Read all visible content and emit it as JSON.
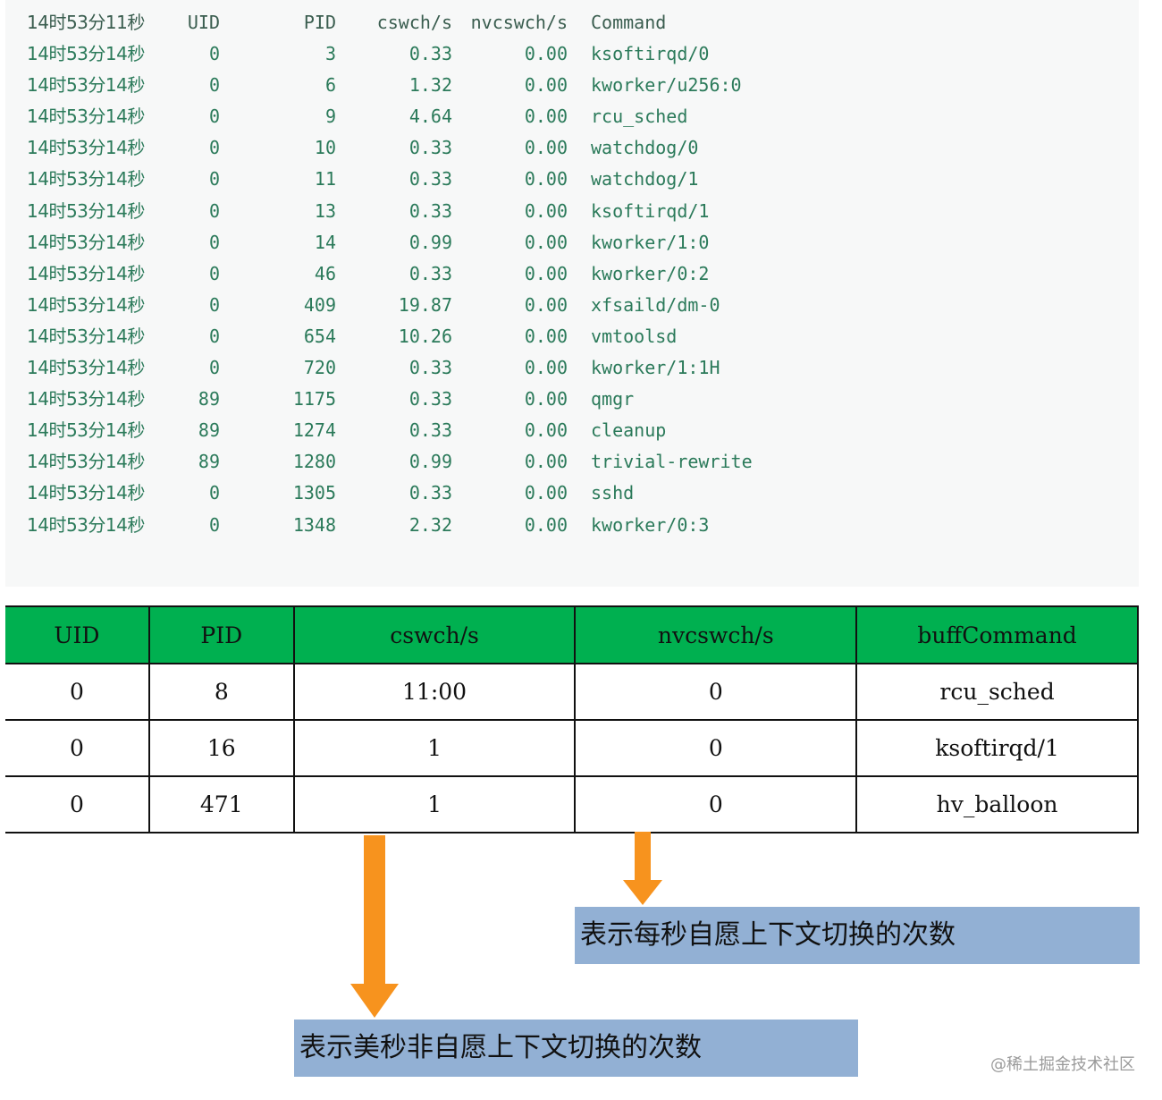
{
  "terminal": {
    "header": {
      "time": "14时53分11秒",
      "uid": "UID",
      "pid": "PID",
      "cswch": "cswch/s",
      "nvcswch": "nvcswch/s",
      "command": "Command"
    },
    "rows": [
      {
        "time": "14时53分14秒",
        "uid": "0",
        "pid": "3",
        "cswch": "0.33",
        "nvcswch": "0.00",
        "command": "ksoftirqd/0"
      },
      {
        "time": "14时53分14秒",
        "uid": "0",
        "pid": "6",
        "cswch": "1.32",
        "nvcswch": "0.00",
        "command": "kworker/u256:0"
      },
      {
        "time": "14时53分14秒",
        "uid": "0",
        "pid": "9",
        "cswch": "4.64",
        "nvcswch": "0.00",
        "command": "rcu_sched"
      },
      {
        "time": "14时53分14秒",
        "uid": "0",
        "pid": "10",
        "cswch": "0.33",
        "nvcswch": "0.00",
        "command": "watchdog/0"
      },
      {
        "time": "14时53分14秒",
        "uid": "0",
        "pid": "11",
        "cswch": "0.33",
        "nvcswch": "0.00",
        "command": "watchdog/1"
      },
      {
        "time": "14时53分14秒",
        "uid": "0",
        "pid": "13",
        "cswch": "0.33",
        "nvcswch": "0.00",
        "command": "ksoftirqd/1"
      },
      {
        "time": "14时53分14秒",
        "uid": "0",
        "pid": "14",
        "cswch": "0.99",
        "nvcswch": "0.00",
        "command": "kworker/1:0"
      },
      {
        "time": "14时53分14秒",
        "uid": "0",
        "pid": "46",
        "cswch": "0.33",
        "nvcswch": "0.00",
        "command": "kworker/0:2"
      },
      {
        "time": "14时53分14秒",
        "uid": "0",
        "pid": "409",
        "cswch": "19.87",
        "nvcswch": "0.00",
        "command": "xfsaild/dm-0"
      },
      {
        "time": "14时53分14秒",
        "uid": "0",
        "pid": "654",
        "cswch": "10.26",
        "nvcswch": "0.00",
        "command": "vmtoolsd"
      },
      {
        "time": "14时53分14秒",
        "uid": "0",
        "pid": "720",
        "cswch": "0.33",
        "nvcswch": "0.00",
        "command": "kworker/1:1H"
      },
      {
        "time": "14时53分14秒",
        "uid": "89",
        "pid": "1175",
        "cswch": "0.33",
        "nvcswch": "0.00",
        "command": "qmgr"
      },
      {
        "time": "14时53分14秒",
        "uid": "89",
        "pid": "1274",
        "cswch": "0.33",
        "nvcswch": "0.00",
        "command": "cleanup"
      },
      {
        "time": "14时53分14秒",
        "uid": "89",
        "pid": "1280",
        "cswch": "0.99",
        "nvcswch": "0.00",
        "command": "trivial-rewrite"
      },
      {
        "time": "14时53分14秒",
        "uid": "0",
        "pid": "1305",
        "cswch": "0.33",
        "nvcswch": "0.00",
        "command": "sshd"
      },
      {
        "time": "14时53分14秒",
        "uid": "0",
        "pid": "1348",
        "cswch": "2.32",
        "nvcswch": "0.00",
        "command": "kworker/0:3"
      }
    ]
  },
  "summary_table": {
    "headers": [
      "UID",
      "PID",
      "cswch/s",
      "nvcswch/s",
      "buffCommand"
    ],
    "rows": [
      [
        "0",
        "8",
        "11:00",
        "0",
        "rcu_sched"
      ],
      [
        "0",
        "16",
        "1",
        "0",
        "ksoftirqd/1"
      ],
      [
        "0",
        "471",
        "1",
        "0",
        "hv_balloon"
      ]
    ]
  },
  "annotations": {
    "voluntary": "表示每秒自愿上下文切换的次数",
    "involuntary": "表示美秒非自愿上下文切换的次数"
  },
  "colors": {
    "header_green": "#00b050",
    "arrow_orange": "#f7931e",
    "callout_blue": "#92b0d4",
    "terminal_text": "#2b7a5a"
  },
  "watermark": "@稀土掘金技术社区"
}
